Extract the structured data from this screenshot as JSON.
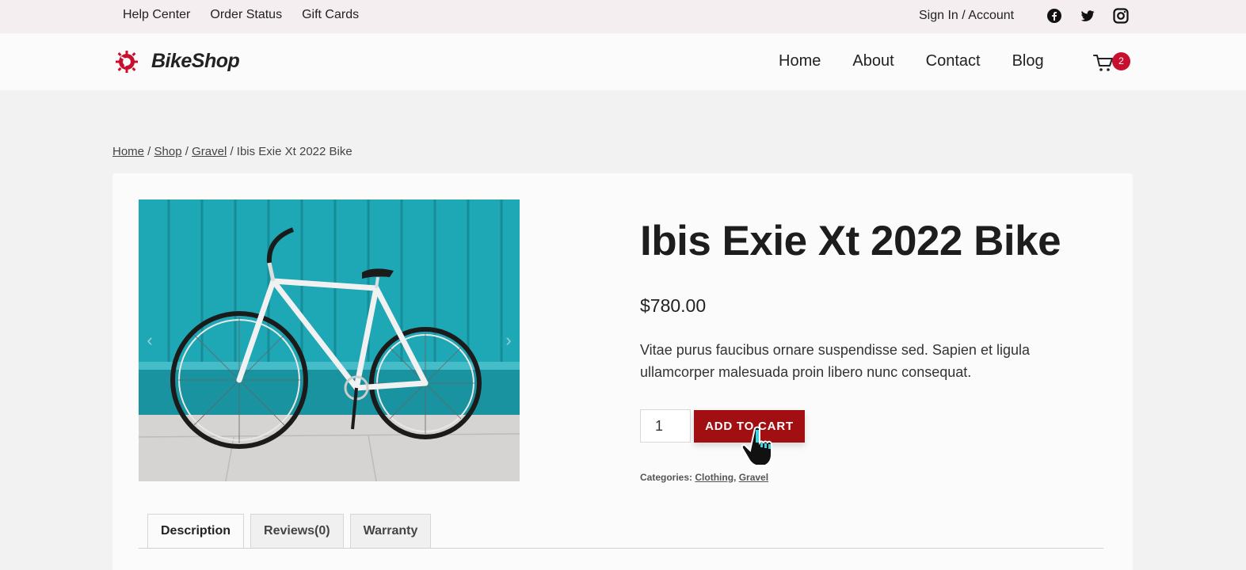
{
  "topbar": {
    "links": [
      "Help Center",
      "Order Status",
      "Gift Cards"
    ],
    "sign_in": "Sign In",
    "separator": " / ",
    "account": "Account",
    "social_icons": [
      "facebook-icon",
      "twitter-icon",
      "instagram-icon"
    ]
  },
  "header": {
    "brand": "BikeShop",
    "nav": [
      "Home",
      "About",
      "Contact",
      "Blog"
    ],
    "cart_count": "2"
  },
  "breadcrumb": {
    "items": [
      "Home",
      "Shop",
      "Gravel"
    ],
    "current": "Ibis Exie Xt 2022 Bike",
    "sep": " / "
  },
  "product": {
    "title": "Ibis Exie Xt 2022 Bike",
    "price": "$780.00",
    "description": "Vitae purus faucibus ornare suspendisse sed. Sapien et ligula ullamcorper malesuada proin libero nunc consequat.",
    "quantity": "1",
    "add_to_cart_label": "ADD TO CART",
    "categories_label": "Categories:",
    "categories": [
      "Clothing",
      "Gravel"
    ]
  },
  "tabs": [
    "Description",
    "Reviews(0)",
    "Warranty"
  ],
  "colors": {
    "accent": "#a10f12",
    "badge": "#c8102e",
    "topbar_bg": "#f5eef1",
    "image_wall": "#1ea7b5"
  }
}
